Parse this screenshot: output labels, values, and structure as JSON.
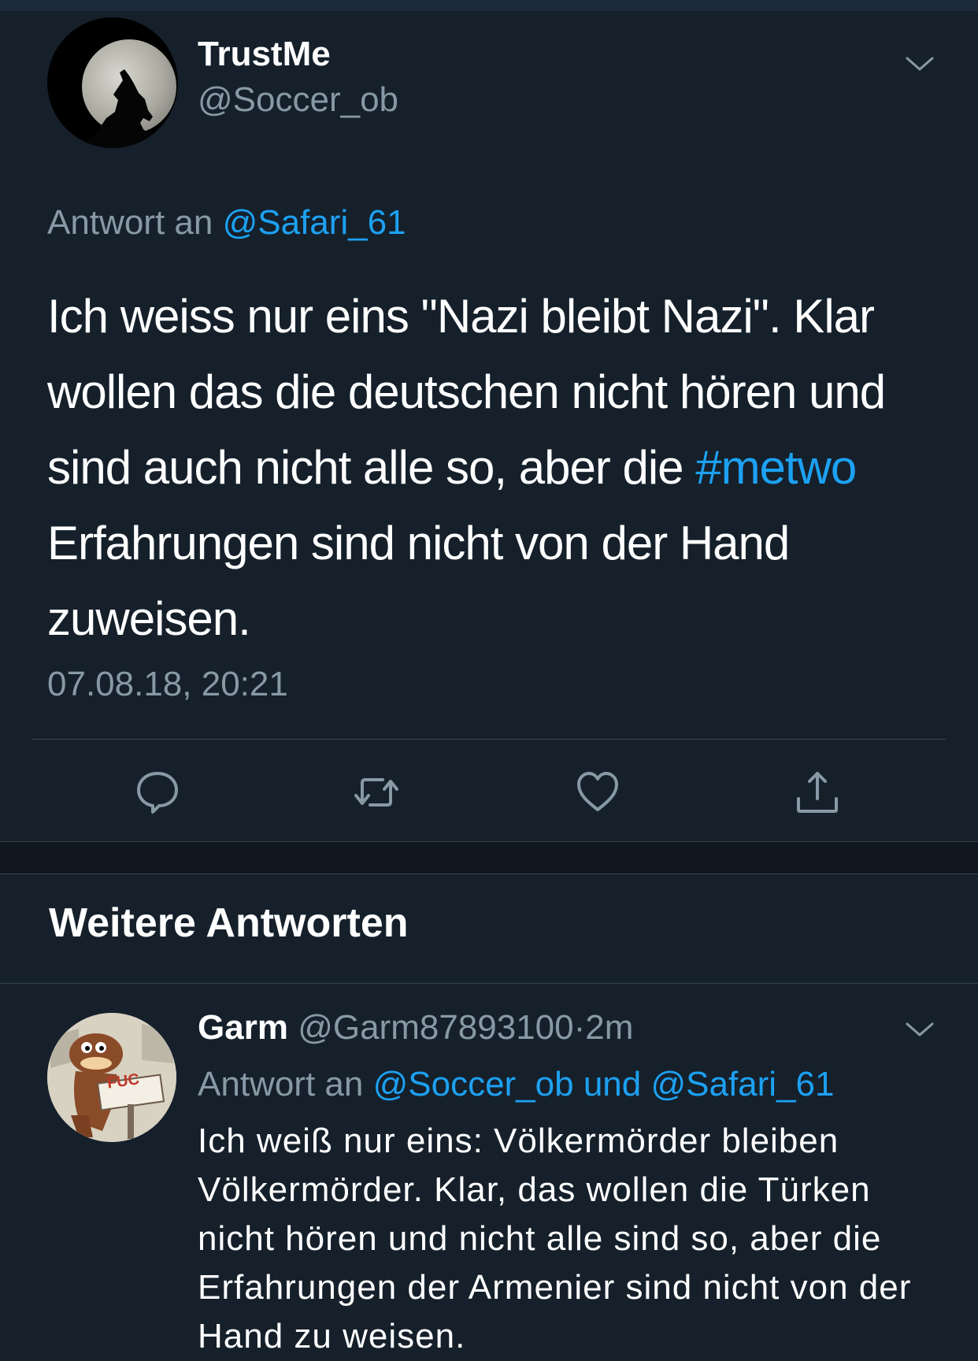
{
  "main_tweet": {
    "display_name": "TrustMe",
    "handle": "@Soccer_ob",
    "reply_prefix": "Antwort an",
    "reply_handle": "@Safari_61",
    "text_part1": "Ich weiss nur eins \"Nazi bleibt Nazi\". Klar wollen das die deutschen nicht hören und sind auch nicht alle so, aber die",
    "hashtag": "#metwo",
    "text_part2": "Erfahrungen sind nicht von der Hand zuweisen.",
    "timestamp": "07.08.18, 20:21"
  },
  "actions": {
    "reply_icon": "reply-icon",
    "retweet_icon": "retweet-icon",
    "like_icon": "heart-icon",
    "share_icon": "share-icon"
  },
  "section": {
    "title": "Weitere Antworten"
  },
  "reply_tweet": {
    "display_name": "Garm",
    "handle": "@Garm87893100",
    "separator": "·",
    "time": "2m",
    "reply_prefix": "Antwort an",
    "reply_handles": "@Soccer_ob und @Safari_61",
    "text": "Ich weiß nur eins: Völkermörder bleiben Völkermörder. Klar, das wollen die Türken nicht hören und nicht alle sind so, aber die Erfahrungen der Armenier sind nicht von der Hand zu weisen.",
    "avatar_sign_text": "FUC"
  },
  "colors": {
    "background": "#15202b",
    "accent": "#1da1f2",
    "muted": "#8899a6",
    "divider": "#38444d"
  }
}
